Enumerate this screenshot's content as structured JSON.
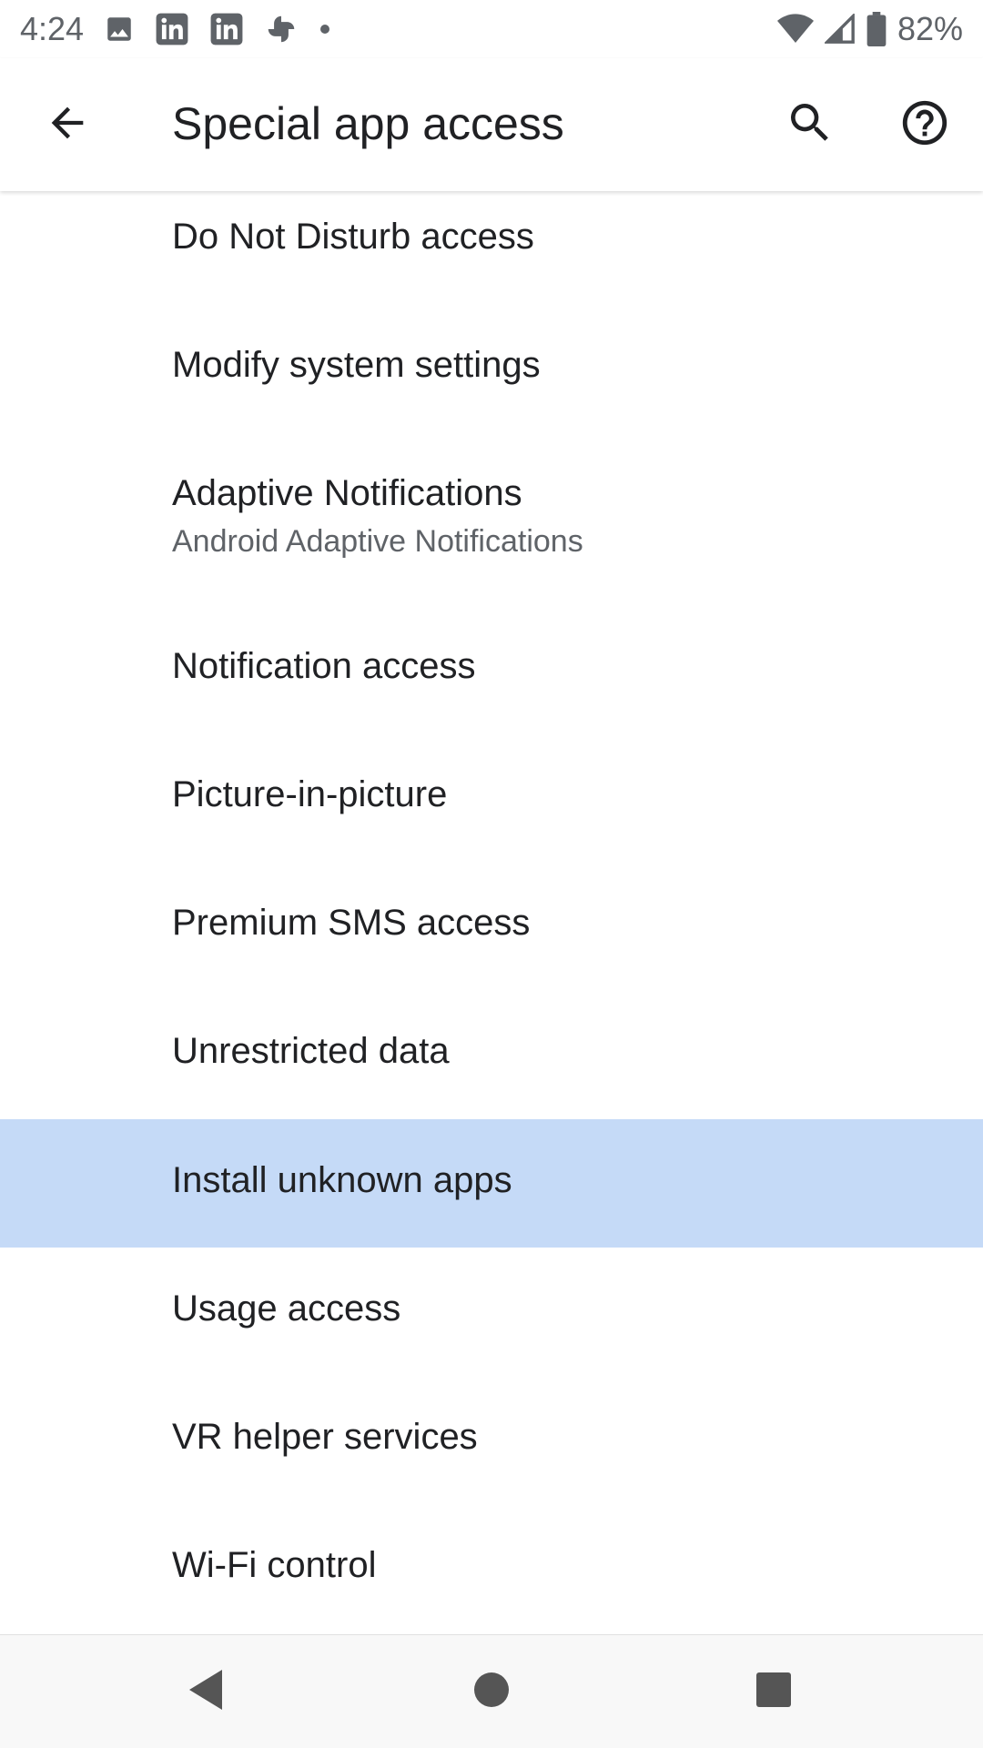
{
  "status_bar": {
    "time": "4:24",
    "battery_percent": "82%",
    "icons": [
      "image-icon",
      "linkedin-icon",
      "linkedin-icon",
      "pinwheel-icon",
      "dot-icon",
      "wifi-icon",
      "signal-icon",
      "battery-icon"
    ]
  },
  "app_bar": {
    "title": "Special app access",
    "icons": [
      "back-arrow-icon",
      "search-icon",
      "help-icon"
    ]
  },
  "list": {
    "items": [
      {
        "label": "Do Not Disturb access"
      },
      {
        "label": "Modify system settings"
      },
      {
        "label": "Adaptive Notifications",
        "subtitle": "Android Adaptive Notifications"
      },
      {
        "label": "Notification access"
      },
      {
        "label": "Picture-in-picture"
      },
      {
        "label": "Premium SMS access"
      },
      {
        "label": "Unrestricted data"
      },
      {
        "label": "Install unknown apps",
        "highlighted": true
      },
      {
        "label": "Usage access"
      },
      {
        "label": "VR helper services"
      },
      {
        "label": "Wi-Fi control"
      }
    ]
  },
  "nav_bar": {
    "icons": [
      "nav-back-icon",
      "nav-home-icon",
      "nav-recents-icon"
    ]
  },
  "colors": {
    "highlight": "#c5daf7",
    "text_primary": "#202124",
    "text_secondary": "#5f6368"
  }
}
